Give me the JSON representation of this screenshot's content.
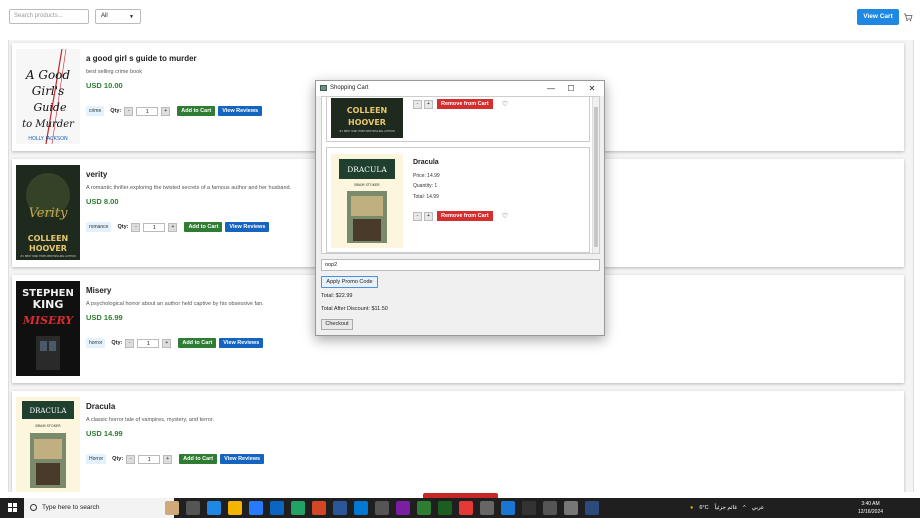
{
  "topbar": {
    "search_placeholder": "Search products...",
    "filter_value": "All",
    "view_cart_label": "View Cart"
  },
  "products": [
    {
      "title": "a good girl s guide to murder",
      "desc": "best selling crime book",
      "price": "USD 10.00",
      "tag": "crime",
      "qty": "1"
    },
    {
      "title": "verity",
      "desc": "A romantic thriller exploring the twisted secrets of a famous author and her husband.",
      "price": "USD 8.00",
      "tag": "romance",
      "qty": "1"
    },
    {
      "title": "Misery",
      "desc": "A psychological horror about an author held captive by his obsessive fan.",
      "price": "USD 16.99",
      "tag": "horror",
      "qty": "1"
    },
    {
      "title": "Dracula",
      "desc": "A classic horror tale of vampires, mystery, and terror.",
      "price": "USD 14.99",
      "tag": "Horror",
      "qty": "1"
    }
  ],
  "controls": {
    "qty_label": "Qty:",
    "minus": "-",
    "plus": "+",
    "add_to_cart": "Add to Cart",
    "view_reviews": "View Reviews"
  },
  "covers": {
    "agggtm": {
      "line1": "A Good",
      "line2": "Girl's",
      "line3": "Guide",
      "line4": "to Murder",
      "author": "HOLLY JACKSON"
    },
    "verity": {
      "title": "Verity",
      "author1": "COLLEEN",
      "author2": "HOOVER",
      "tagline": "#1 NEW YORK TIMES BESTSELLING AUTHOR"
    },
    "misery": {
      "author1": "STEPHEN",
      "author2": "KING",
      "title": "MISERY"
    },
    "dracula": {
      "title": "DRACULA",
      "author": "BRAM STOKER"
    }
  },
  "cart_window": {
    "title": "Shopping Cart",
    "min": "—",
    "max": "☐",
    "close": "✕",
    "item_partial": {
      "remove_label": "Remove from Cart",
      "cover_author1": "COLLEEN",
      "cover_author2": "HOOVER",
      "cover_tagline": "#1 NEW YORK TIMES BESTSELLING AUTHOR"
    },
    "item": {
      "title": "Dracula",
      "price": "Price: 14.99",
      "quantity": "Quantity: 1",
      "total": "Total: 14.99",
      "remove_label": "Remove from Cart"
    },
    "promo_value": "oop2",
    "apply_label": "Apply Promo Code",
    "total": "Total: $22.99",
    "total_after": "Total After Discount: $11.50",
    "checkout_label": "Checkout"
  },
  "taskbar": {
    "search_text": "Type here to search",
    "weather": "6°C",
    "weather_text": "غائم جزئياً",
    "language": "عربي",
    "time": "3:40 AM",
    "date": "12/16/2024"
  },
  "colors": {
    "accent_blue": "#1e88e5",
    "add_green": "#2e7d32",
    "remove_red": "#d32f2f",
    "reviews_blue": "#1565c0"
  }
}
